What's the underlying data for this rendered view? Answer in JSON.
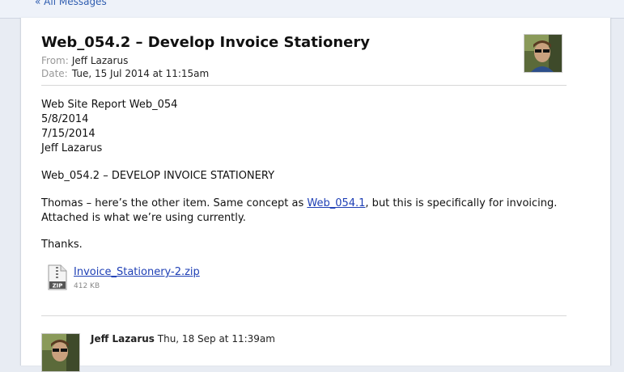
{
  "nav": {
    "back_label": "« All Messages"
  },
  "message": {
    "subject": "Web_054.2 – Develop Invoice Stationery",
    "from_label": "From:",
    "from_name": "Jeff Lazarus",
    "date_label": "Date:",
    "date_value": "Tue, 15 Jul 2014 at 11:15am",
    "avatar_icon": "user-photo-icon",
    "body": {
      "line1": "Web Site Report Web_054",
      "line2": "5/8/2014",
      "line3": "7/15/2014",
      "line4": "Jeff Lazarus",
      "line5": "Web_054.2 – DEVELOP INVOICE STATIONERY",
      "line6_before": "Thomas – here’s the other item. Same concept as ",
      "line6_link": "Web_054.1",
      "line6_after": ", but this is specifically for invoicing.",
      "line7": "Attached is what we’re using currently.",
      "line8": "Thanks."
    },
    "attachment": {
      "icon": "zip-file-icon",
      "icon_label": "ZIP",
      "name": "Invoice_Stationery-2.zip",
      "size": "412 KB"
    }
  },
  "reply": {
    "author": "Jeff Lazarus",
    "date": "Thu, 18 Sep at 11:39am",
    "avatar_icon": "user-photo-icon"
  },
  "colors": {
    "link": "#1e3fb5",
    "background": "#e8ecf3",
    "panel": "#ffffff"
  }
}
